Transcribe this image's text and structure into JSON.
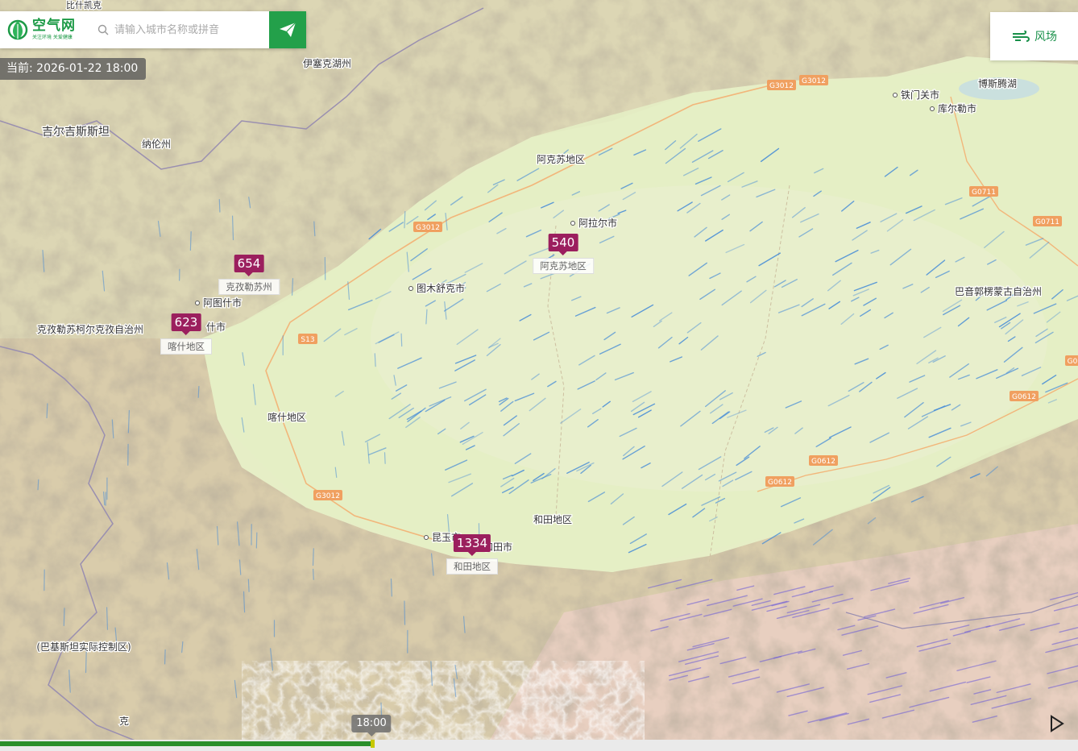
{
  "header": {
    "logo_title": "空气网",
    "logo_tagline": "关注环境 关爱健康",
    "search_placeholder": "请输入城市名称或拼音"
  },
  "current_time": "当前: 2026-01-22 18:00",
  "layer_toggle": {
    "label": "风场",
    "icon": "wind-icon"
  },
  "aqi_markers": [
    {
      "value": "654",
      "region": "克孜勒苏州"
    },
    {
      "value": "623",
      "region": "喀什地区"
    },
    {
      "value": "540",
      "region": "阿克苏地区"
    },
    {
      "value": "1334",
      "region": "和田地区"
    }
  ],
  "map_labels": [
    "吉尔吉斯斯坦",
    "纳伦州",
    "伊塞克湖州",
    "阿克苏地区",
    "阿拉尔市",
    "图木舒克市",
    "阿图什市",
    "克孜勒苏柯尔克孜自治州",
    "什市",
    "喀什地区",
    "和田地区",
    "昆玉市",
    "和田市",
    "铁门关市",
    "库尔勒市",
    "博斯腾湖",
    "巴音郭楞蒙古自治州",
    "(巴基斯坦实际控制区)",
    "克",
    "比什凯克"
  ],
  "road_shields": [
    "G3012",
    "G3012",
    "G3012",
    "G3012",
    "S13",
    "G0711",
    "G0711",
    "G0612",
    "G0612",
    "G0612",
    "G0"
  ],
  "timeline": {
    "tooltip": "18:00",
    "progress": 0.345
  },
  "colors": {
    "brand_green": "#23a04a",
    "aqi_marker": "#9b1f5e",
    "wind_particle": "#3f88d8",
    "desert": "#e8efc9",
    "mountain": "#d8c9a4"
  }
}
